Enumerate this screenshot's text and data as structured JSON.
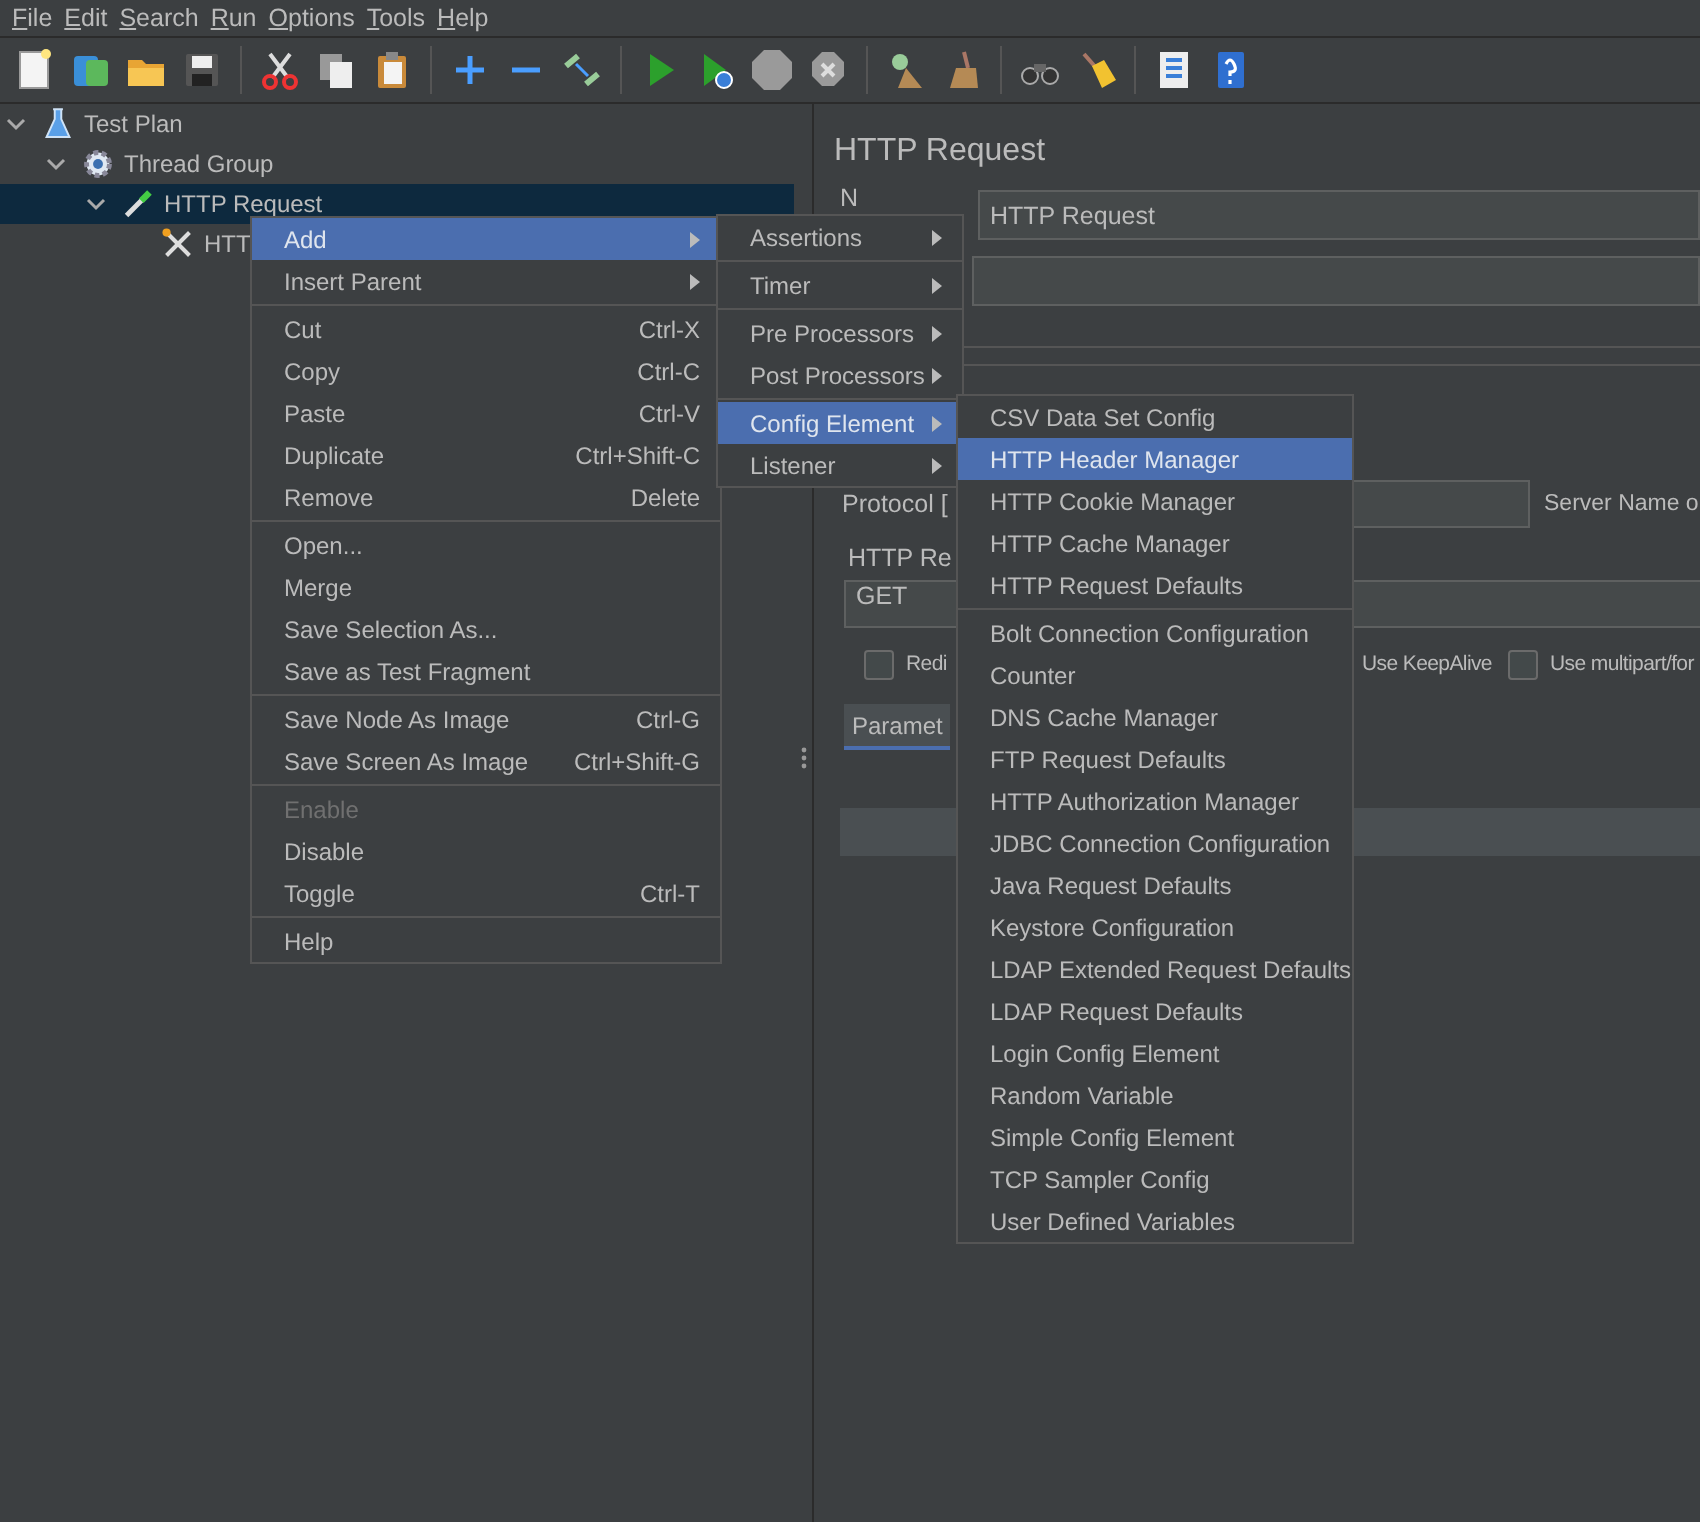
{
  "menu_bar": [
    {
      "label": "File"
    },
    {
      "label": "Edit"
    },
    {
      "label": "Search"
    },
    {
      "label": "Run"
    },
    {
      "label": "Options"
    },
    {
      "label": "Tools"
    },
    {
      "label": "Help"
    }
  ],
  "tree": {
    "label": "Test Plan",
    "kind": "plan",
    "expanded": true,
    "selected": false,
    "children": [
      {
        "label": "Thread Group",
        "kind": "group",
        "expanded": true,
        "selected": false,
        "children": [
          {
            "label": "HTTP Request",
            "kind": "sampler",
            "expanded": true,
            "selected": true,
            "children": [
              {
                "label": "HTT",
                "kind": "config",
                "selected": false
              }
            ]
          }
        ]
      }
    ]
  },
  "panel": {
    "title": "HTTP Request",
    "name_label": "N",
    "name_value": "HTTP Request",
    "protocol_label": "Protocol [",
    "server_label": "Server Name o",
    "request_group": "HTTP Re",
    "method": "GET",
    "options": [
      {
        "label": "Redi",
        "checked": false
      },
      {
        "label": "Use KeepAlive"
      },
      {
        "label": "Use multipart/for",
        "checked": false
      }
    ],
    "tabs": [
      {
        "label": "Paramet",
        "selected": true
      }
    ]
  },
  "context_menu": {
    "groups": [
      [
        {
          "label": "Add",
          "kind": "submenu",
          "selected": true,
          "disabled": false
        },
        {
          "label": "Insert Parent",
          "kind": "submenu",
          "selected": false,
          "disabled": false
        }
      ],
      [
        {
          "label": "Cut",
          "kind": "command",
          "shortcut": "Ctrl-X",
          "selected": false,
          "disabled": false
        },
        {
          "label": "Copy",
          "kind": "command",
          "shortcut": "Ctrl-C",
          "selected": false,
          "disabled": false
        },
        {
          "label": "Paste",
          "kind": "command",
          "shortcut": "Ctrl-V",
          "selected": false,
          "disabled": false
        },
        {
          "label": "Duplicate",
          "kind": "command",
          "shortcut": "Ctrl+Shift-C",
          "selected": false,
          "disabled": false
        },
        {
          "label": "Remove",
          "kind": "command",
          "shortcut": "Delete",
          "selected": false,
          "disabled": false
        }
      ],
      [
        {
          "label": "Open...",
          "kind": "command",
          "selected": false,
          "disabled": false
        },
        {
          "label": "Merge",
          "kind": "command",
          "selected": false,
          "disabled": false
        },
        {
          "label": "Save Selection As...",
          "kind": "command",
          "selected": false,
          "disabled": false
        },
        {
          "label": "Save as Test Fragment",
          "kind": "command",
          "selected": false,
          "disabled": false
        }
      ],
      [
        {
          "label": "Save Node As Image",
          "kind": "command",
          "shortcut": "Ctrl-G",
          "selected": false,
          "disabled": false
        },
        {
          "label": "Save Screen As Image",
          "kind": "command",
          "shortcut": "Ctrl+Shift-G",
          "selected": false,
          "disabled": false
        }
      ],
      [
        {
          "label": "Enable",
          "kind": "command",
          "selected": false,
          "disabled": true
        },
        {
          "label": "Disable",
          "kind": "command",
          "selected": false,
          "disabled": false
        },
        {
          "label": "Toggle",
          "kind": "command",
          "shortcut": "Ctrl-T",
          "selected": false,
          "disabled": false
        }
      ],
      [
        {
          "label": "Help",
          "kind": "command",
          "selected": false,
          "disabled": false
        }
      ]
    ]
  },
  "add_menu": {
    "groups": [
      [
        {
          "label": "Assertions",
          "kind": "submenu",
          "selected": false,
          "disabled": false
        }
      ],
      [
        {
          "label": "Timer",
          "kind": "submenu",
          "selected": false,
          "disabled": false
        }
      ],
      [
        {
          "label": "Pre Processors",
          "kind": "submenu",
          "selected": false,
          "disabled": false
        },
        {
          "label": "Post Processors",
          "kind": "submenu",
          "selected": false,
          "disabled": false
        }
      ],
      [
        {
          "label": "Config Element",
          "kind": "submenu",
          "selected": true,
          "disabled": false
        },
        {
          "label": "Listener",
          "kind": "submenu",
          "selected": false,
          "disabled": false
        }
      ]
    ]
  },
  "config_menu": {
    "groups": [
      [
        {
          "label": "CSV Data Set Config",
          "kind": "command",
          "selected": false,
          "disabled": false
        },
        {
          "label": "HTTP Header Manager",
          "kind": "command",
          "selected": true,
          "disabled": false
        },
        {
          "label": "HTTP Cookie Manager",
          "kind": "command",
          "selected": false,
          "disabled": false
        },
        {
          "label": "HTTP Cache Manager",
          "kind": "command",
          "selected": false,
          "disabled": false
        },
        {
          "label": "HTTP Request Defaults",
          "kind": "command",
          "selected": false,
          "disabled": false
        }
      ],
      [
        {
          "label": "Bolt Connection Configuration",
          "kind": "command",
          "selected": false,
          "disabled": false
        },
        {
          "label": "Counter",
          "kind": "command",
          "selected": false,
          "disabled": false
        },
        {
          "label": "DNS Cache Manager",
          "kind": "command",
          "selected": false,
          "disabled": false
        },
        {
          "label": "FTP Request Defaults",
          "kind": "command",
          "selected": false,
          "disabled": false
        },
        {
          "label": "HTTP Authorization Manager",
          "kind": "command",
          "selected": false,
          "disabled": false
        },
        {
          "label": "JDBC Connection Configuration",
          "kind": "command",
          "selected": false,
          "disabled": false
        },
        {
          "label": "Java Request Defaults",
          "kind": "command",
          "selected": false,
          "disabled": false
        },
        {
          "label": "Keystore Configuration",
          "kind": "command",
          "selected": false,
          "disabled": false
        },
        {
          "label": "LDAP Extended Request Defaults",
          "kind": "command",
          "selected": false,
          "disabled": false
        },
        {
          "label": "LDAP Request Defaults",
          "kind": "command",
          "selected": false,
          "disabled": false
        },
        {
          "label": "Login Config Element",
          "kind": "command",
          "selected": false,
          "disabled": false
        },
        {
          "label": "Random Variable",
          "kind": "command",
          "selected": false,
          "disabled": false
        },
        {
          "label": "Simple Config Element",
          "kind": "command",
          "selected": false,
          "disabled": false
        },
        {
          "label": "TCP Sampler Config",
          "kind": "command",
          "selected": false,
          "disabled": false
        },
        {
          "label": "User Defined Variables",
          "kind": "command",
          "selected": false,
          "disabled": false
        }
      ]
    ]
  }
}
